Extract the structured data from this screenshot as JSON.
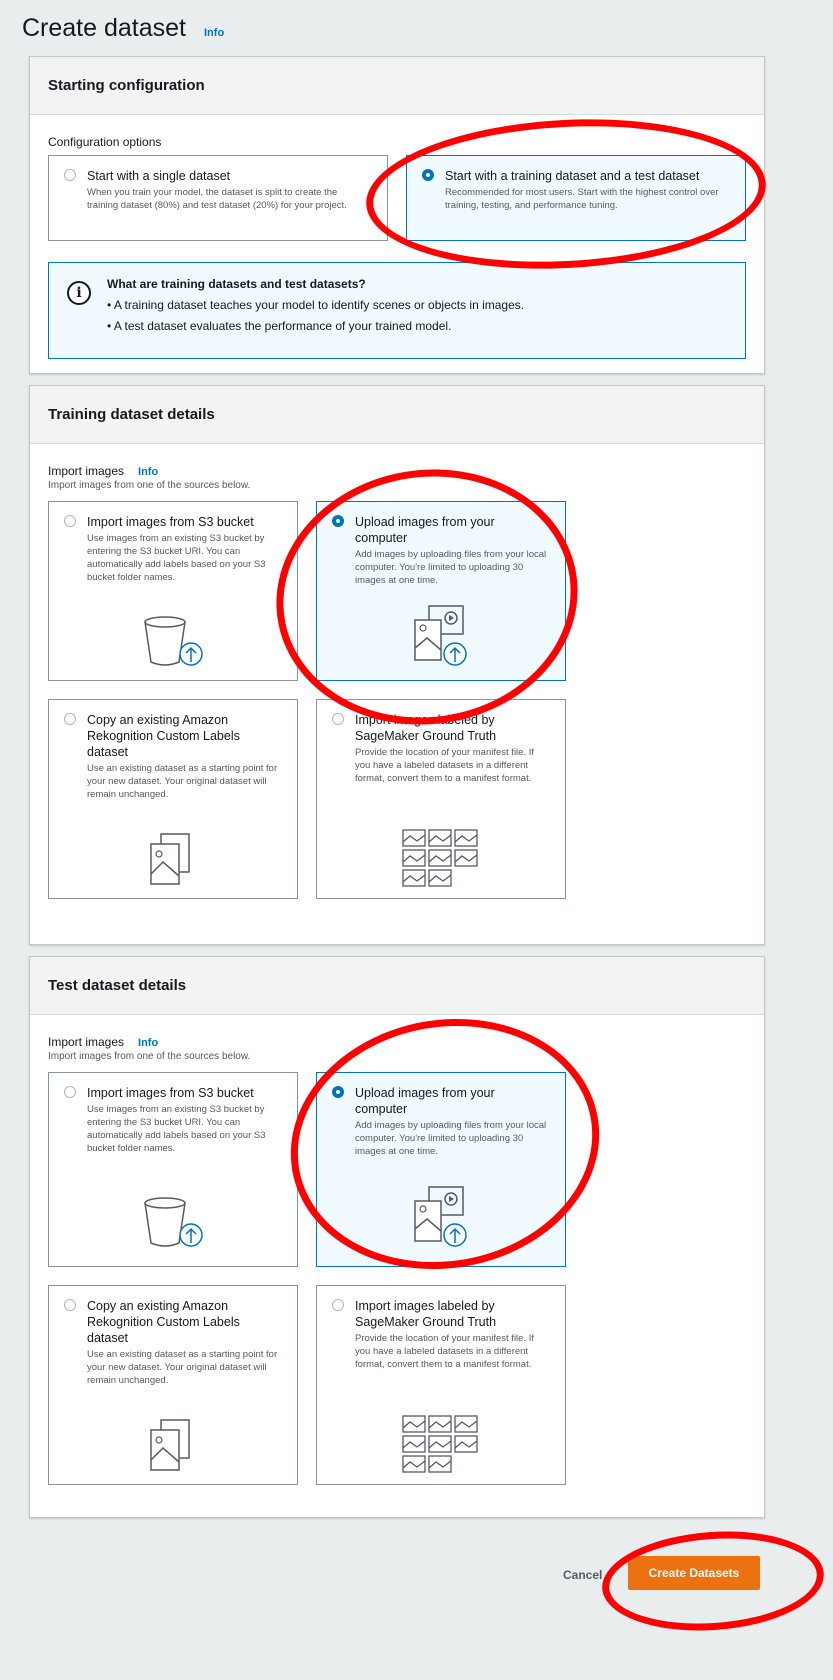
{
  "page": {
    "title": "Create dataset",
    "info": "Info"
  },
  "starting": {
    "header": "Starting configuration",
    "label": "Configuration options",
    "options": [
      {
        "title": "Start with a single dataset",
        "desc": "When you train your model, the dataset is split to create the training dataset (80%) and test dataset (20%) for your project.",
        "selected": false
      },
      {
        "title": "Start with a training dataset and a test dataset",
        "desc": "Recommended for most users. Start with the highest control over training, testing, and performance tuning.",
        "selected": true
      }
    ],
    "alert": {
      "title": "What are training datasets and test datasets?",
      "lines": [
        "• A training dataset teaches your model to identify scenes or objects in images.",
        "• A test dataset evaluates the performance of your trained model."
      ]
    }
  },
  "training": {
    "header": "Training dataset details",
    "label": "Import images",
    "info": "Info",
    "desc": "Import images from one of the sources below.",
    "tiles": [
      {
        "title": "Import images from S3 bucket",
        "desc": "Use images from an existing S3 bucket by entering the S3 bucket URI. You can automatically add labels based on your S3 bucket folder names.",
        "icon": "bucket-upload-icon",
        "selected": false
      },
      {
        "title": "Upload images from your computer",
        "desc": "Add images by uploading files from your local computer. You're limited to uploading 30 images at one time.",
        "icon": "images-upload-icon",
        "selected": true
      },
      {
        "title": "Copy an existing Amazon Rekognition Custom Labels dataset",
        "desc": "Use an existing dataset as a starting point for your new dataset. Your original dataset will remain unchanged.",
        "icon": "copy-images-icon",
        "selected": false
      },
      {
        "title": "Import images labeled by SageMaker Ground Truth",
        "desc": "Provide the location of your manifest file. If you have a labeled datasets in a different format, convert them to a manifest format.",
        "icon": "image-grid-icon",
        "selected": false
      }
    ]
  },
  "test": {
    "header": "Test dataset details",
    "label": "Import images",
    "info": "Info",
    "desc": "Import images from one of the sources below.",
    "tiles": [
      {
        "title": "Import images from S3 bucket",
        "desc": "Use images from an existing S3 bucket by entering the S3 bucket URI. You can automatically add labels based on your S3 bucket folder names.",
        "icon": "bucket-upload-icon",
        "selected": false
      },
      {
        "title": "Upload images from your computer",
        "desc": "Add images by uploading files from your local computer. You're limited to uploading 30 images at one time.",
        "icon": "images-upload-icon",
        "selected": true
      },
      {
        "title": "Copy an existing Amazon Rekognition Custom Labels dataset",
        "desc": "Use an existing dataset as a starting point for your new dataset. Your original dataset will remain unchanged.",
        "icon": "copy-images-icon",
        "selected": false
      },
      {
        "title": "Import images labeled by SageMaker Ground Truth",
        "desc": "Provide the location of your manifest file. If you have a labeled datasets in a different format, convert them to a manifest format.",
        "icon": "image-grid-icon",
        "selected": false
      }
    ]
  },
  "footer": {
    "cancel": "Cancel",
    "create": "Create Datasets"
  },
  "colors": {
    "accent": "#0073bb",
    "primary_button": "#ec7211",
    "annotation": "#ff0000"
  }
}
